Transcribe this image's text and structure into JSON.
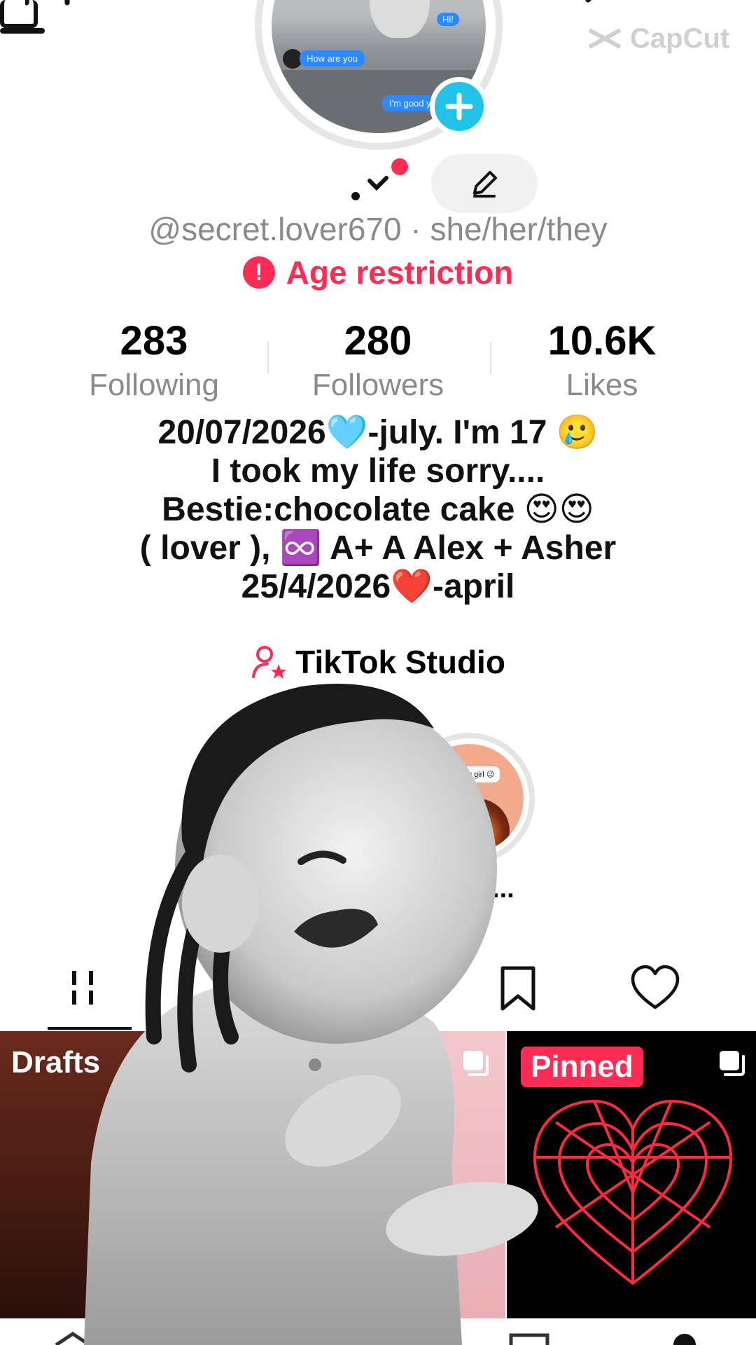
{
  "watermark": {
    "text": "CapCut"
  },
  "avatar": {
    "chat_bubbles": [
      "Hi!",
      "How are you",
      "I'm good y"
    ]
  },
  "profile": {
    "handle_line": "@secret.lover670 · she/her/they",
    "age_restriction": "Age restriction",
    "age_icon": "!"
  },
  "stats": {
    "following": {
      "value": "283",
      "label": "Following"
    },
    "followers": {
      "value": "280",
      "label": "Followers"
    },
    "likes": {
      "value": "10.6K",
      "label": "Likes"
    }
  },
  "bio": {
    "lines": [
      "20/07/2026🩵-july.    I'm 17 🥲",
      "I took my life sorry....",
      "Bestie:chocolate cake 😍😍",
      "( lover ), ♾️ A+ A Alex + Asher",
      "25/4/2026❤️-april"
    ]
  },
  "studio": {
    "label": "TikTok Studio",
    "icon": "creator-star-icon"
  },
  "highlight": {
    "bubble": "I love my girl 😉",
    "label": "irlfrie..."
  },
  "tabs": {
    "videos_icon": "grid-icon",
    "saved_icon": "bookmark-icon",
    "liked_icon": "heart-outline-icon"
  },
  "grid": {
    "drafts_label": "Drafts",
    "pinned_label": "Pinned"
  },
  "colors": {
    "accent": "#fe2c55",
    "plus_button": "#21c4e8",
    "muted_text": "#8a8a8a"
  }
}
